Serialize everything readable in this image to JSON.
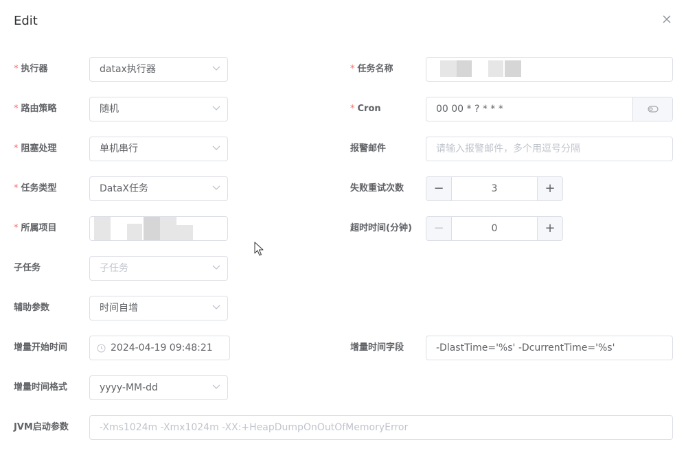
{
  "dialog": {
    "title": "Edit"
  },
  "form": {
    "executor": {
      "label": "执行器",
      "required": "*",
      "value": "datax执行器"
    },
    "task_name": {
      "label": "任务名称",
      "required": "*",
      "value": ""
    },
    "route_strategy": {
      "label": "路由策略",
      "required": "*",
      "value": "随机"
    },
    "cron": {
      "label": "Cron",
      "required": "*",
      "value": "00 00 * ? * * *"
    },
    "block_strategy": {
      "label": "阻塞处理",
      "required": "*",
      "value": "单机串行"
    },
    "alarm_email": {
      "label": "报警邮件",
      "placeholder": "请输入报警邮件，多个用逗号分隔"
    },
    "task_type": {
      "label": "任务类型",
      "required": "*",
      "value": "DataX任务"
    },
    "retry_count": {
      "label": "失败重试次数",
      "value": "3",
      "minus": "−",
      "plus": "+"
    },
    "project": {
      "label": "所属项目",
      "required": "*",
      "value": ""
    },
    "timeout": {
      "label": "超时时间(分钟)",
      "value": "0",
      "minus": "−",
      "plus": "+"
    },
    "sub_task": {
      "label": "子任务",
      "placeholder": "子任务"
    },
    "aux_param": {
      "label": "辅助参数",
      "value": "时间自增"
    },
    "incr_start_time": {
      "label": "增量开始时间",
      "value": "2024-04-19 09:48:21"
    },
    "incr_time_field": {
      "label": "增量时间字段",
      "value": "-DlastTime='%s' -DcurrentTime='%s'"
    },
    "incr_time_format": {
      "label": "增量时间格式",
      "value": "yyyy-MM-dd"
    },
    "jvm_params": {
      "label": "JVM启动参数",
      "placeholder": "-Xms1024m -Xmx1024m -XX:+HeapDumpOnOutOfMemoryError"
    }
  },
  "colors": {
    "required": "#f56c6c",
    "border": "#dcdfe6",
    "placeholder": "#c0c4cc",
    "addon_bg": "#f5f7fa"
  }
}
